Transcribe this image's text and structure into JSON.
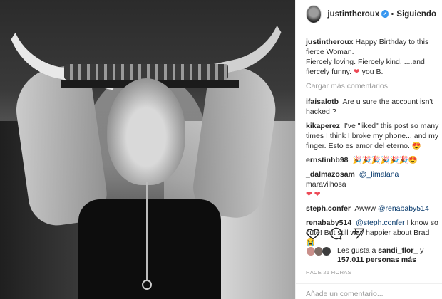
{
  "post": {
    "image_alt": "post-photo"
  },
  "header": {
    "username": "justintheroux",
    "separator": "•",
    "follow_label": "Siguiendo",
    "verified_glyph": "✔"
  },
  "caption": {
    "user": "justintheroux",
    "text_1": "Happy Birthday to this fierce Woman.",
    "text_2": "Fiercely loving. Fiercely kind. ....and fiercely funny.",
    "text_3": "you B."
  },
  "load_more_label": "Cargar más comentarios",
  "comments": [
    {
      "user": "ifaisalotb",
      "text": "Are u sure the account isn't hacked ?"
    },
    {
      "user": "kikaperez",
      "text": "I've \"liked\" this post so many times I think I broke my phone... and my finger. Esto es amor del eterno."
    },
    {
      "user": "ernstinhb98",
      "text": ""
    },
    {
      "user": "_dalmazosam",
      "mention": "@_limalana",
      "text": "maravilhosa"
    },
    {
      "user": "steph.confer",
      "text": "Awww",
      "mention": "@renababy514"
    },
    {
      "user": "renababy514",
      "mention": "@steph.confer",
      "text": "I know so cute! But still way happier about Brad"
    }
  ],
  "likes": {
    "prefix": "Les gusta a",
    "user": "sandi_flor_",
    "connector": "y",
    "count": "157.011 personas más"
  },
  "timestamp": "HACE 21 HORAS",
  "add_comment_placeholder": "Añade un comentario...",
  "colors": {
    "heart": "#ed4956",
    "verified": "#3897f0",
    "mention": "#003569"
  }
}
